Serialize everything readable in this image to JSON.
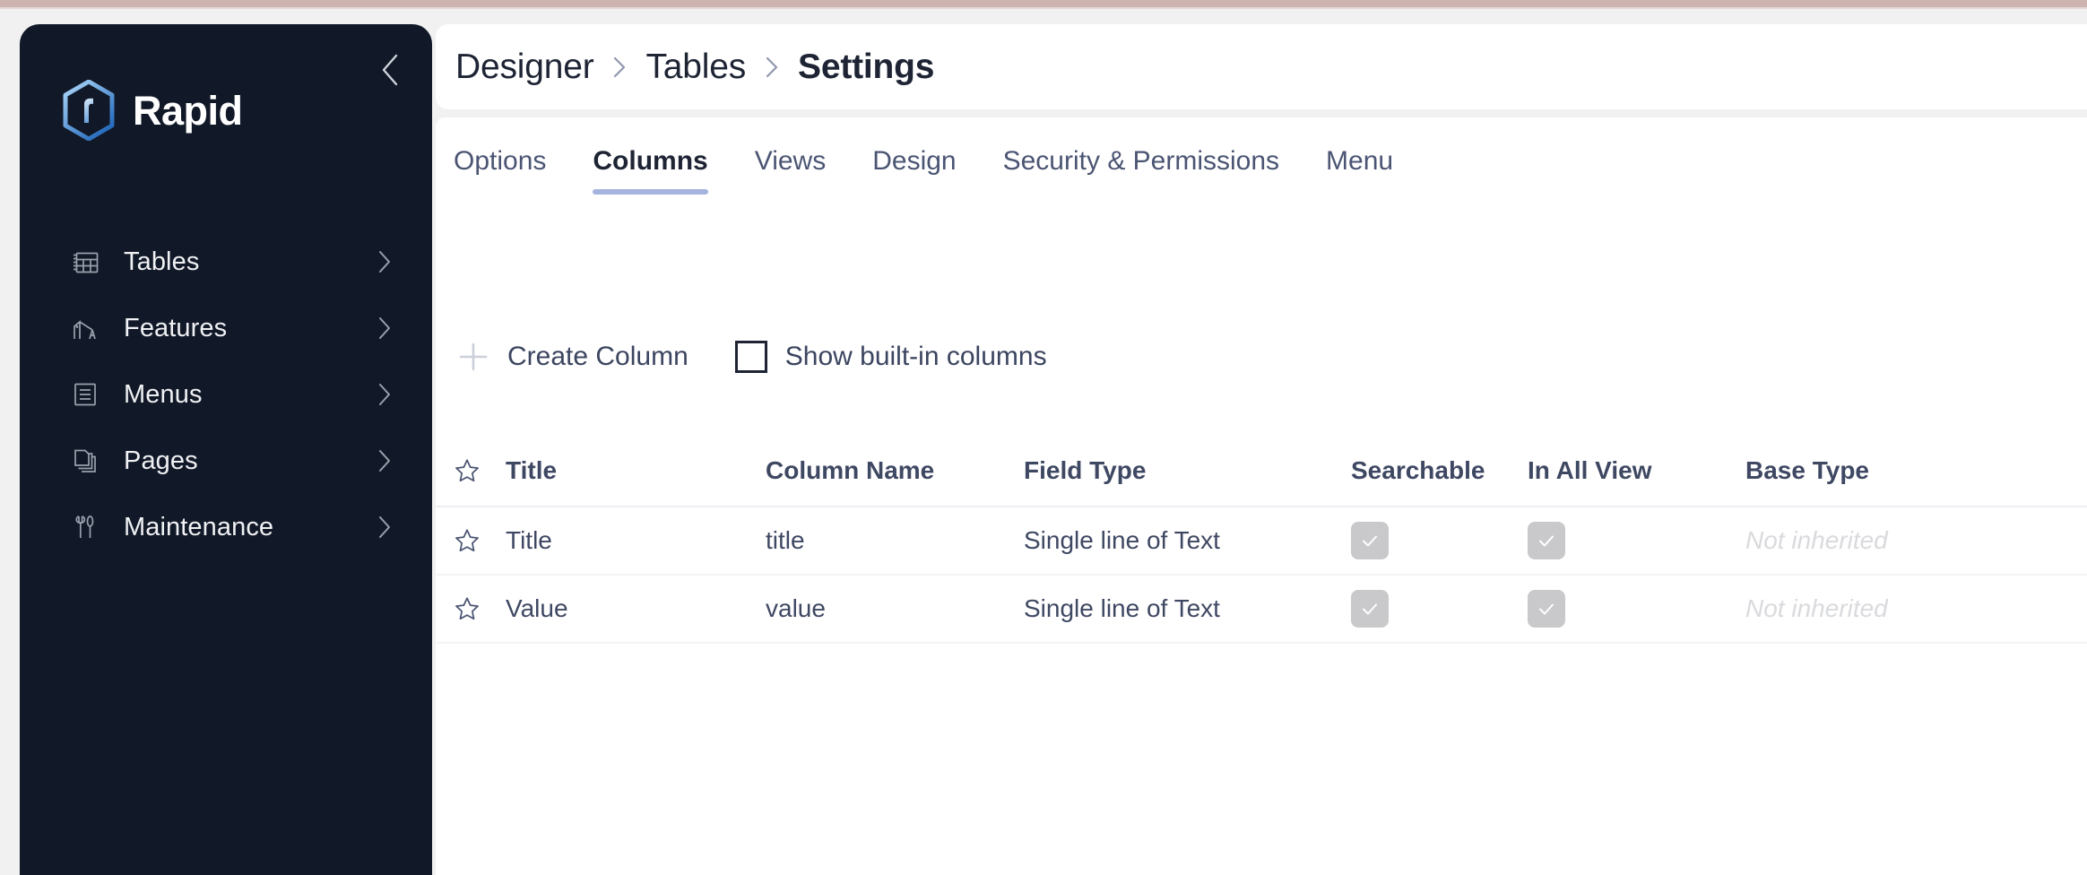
{
  "window": {
    "accent_bar_color": "#cdb4b0",
    "page_background": "#f1f1f1"
  },
  "sidebar": {
    "background": "#111827",
    "brand": {
      "name": "Rapid",
      "logo_icon": "rapid-hexagon-logo",
      "logo_colors": [
        "#9ecdf4",
        "#1d63b8"
      ]
    },
    "collapse_icon": "chevron-left-icon",
    "items": [
      {
        "label": "Tables",
        "icon": "table-grid-icon",
        "chevron": "chevron-right-icon"
      },
      {
        "label": "Features",
        "icon": "crane-icon",
        "chevron": "chevron-right-icon"
      },
      {
        "label": "Menus",
        "icon": "menu-list-icon",
        "chevron": "chevron-right-icon"
      },
      {
        "label": "Pages",
        "icon": "pages-stack-icon",
        "chevron": "chevron-right-icon"
      },
      {
        "label": "Maintenance",
        "icon": "tools-icon",
        "chevron": "chevron-right-icon"
      }
    ]
  },
  "header": {
    "breadcrumb": [
      {
        "label": "Designer",
        "current": false
      },
      {
        "label": "Tables",
        "current": false
      },
      {
        "label": "Settings",
        "current": true
      }
    ],
    "separator_icon": "chevron-right-icon"
  },
  "tabs": {
    "active_underline_color": "#a5b4de",
    "items": [
      {
        "label": "Options",
        "active": false
      },
      {
        "label": "Columns",
        "active": true
      },
      {
        "label": "Views",
        "active": false
      },
      {
        "label": "Design",
        "active": false
      },
      {
        "label": "Security & Permissions",
        "active": false
      },
      {
        "label": "Menu",
        "active": false
      }
    ]
  },
  "toolbar": {
    "create_column_label": "Create Column",
    "create_column_icon": "plus-icon",
    "show_builtin_label": "Show built-in columns",
    "show_builtin_checked": false
  },
  "table": {
    "favorite_header_icon": "star-outline-icon",
    "headers": {
      "title": "Title",
      "column_name": "Column Name",
      "field_type": "Field Type",
      "searchable": "Searchable",
      "in_all_view": "In All View",
      "base_type": "Base Type"
    },
    "rows": [
      {
        "star_icon": "star-outline-icon",
        "title": "Title",
        "column_name": "title",
        "field_type": "Single line of Text",
        "searchable": true,
        "in_all_view": true,
        "base_type": "Not inherited"
      },
      {
        "star_icon": "star-outline-icon",
        "title": "Value",
        "column_name": "value",
        "field_type": "Single line of Text",
        "searchable": true,
        "in_all_view": true,
        "base_type": "Not inherited"
      }
    ],
    "checkbox_checked_color": "#c9c9cb",
    "checkbox_check_icon": "check-icon"
  }
}
